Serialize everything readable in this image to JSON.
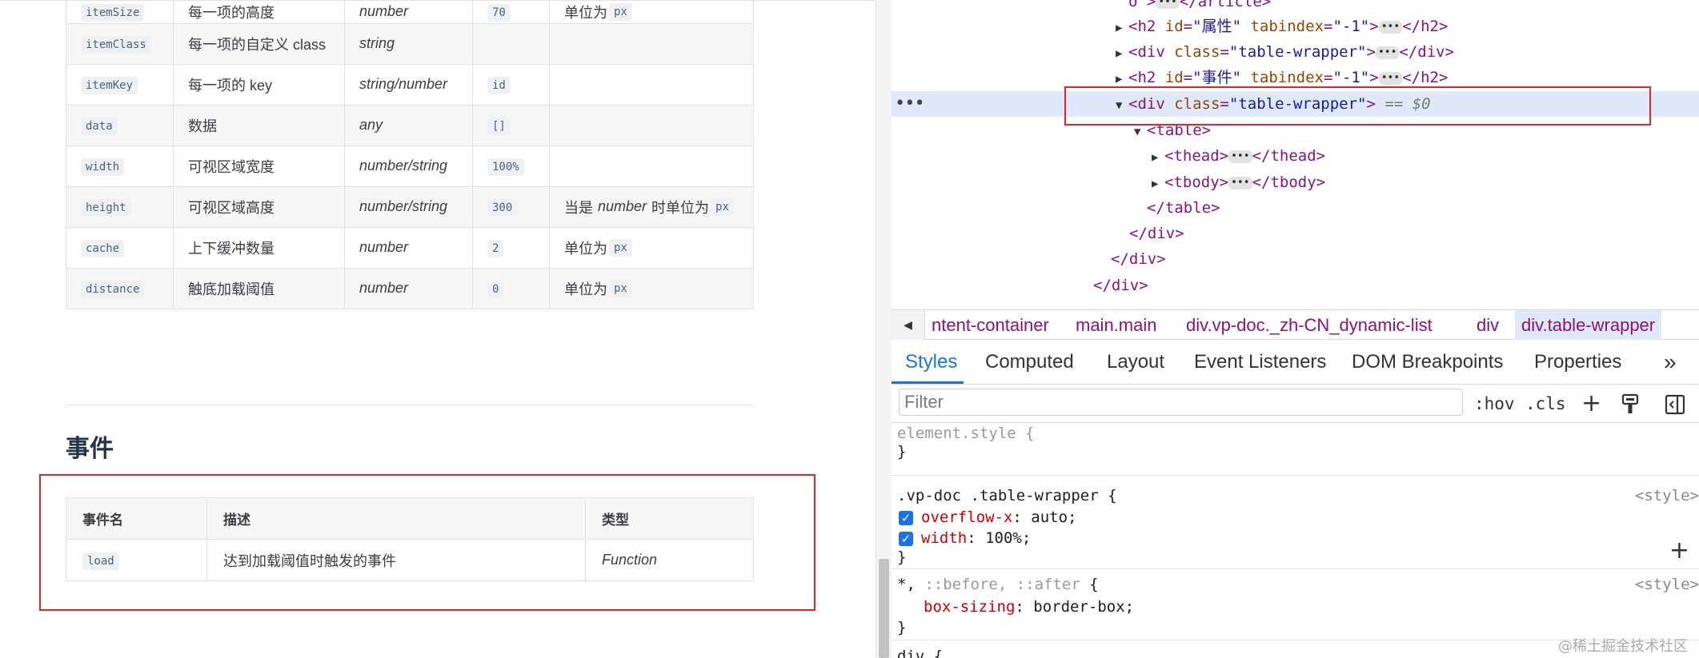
{
  "doc": {
    "props_rows": [
      {
        "name": "itemSize",
        "desc": "每一项的高度",
        "type": "number",
        "default": "70",
        "note_prefix": "单位为",
        "note_code": "px"
      },
      {
        "name": "itemClass",
        "desc": "每一项的自定义 class",
        "type": "string",
        "default": "",
        "note_prefix": "",
        "note_code": ""
      },
      {
        "name": "itemKey",
        "desc": "每一项的 key",
        "type": "string/number",
        "default": "id",
        "note_prefix": "",
        "note_code": ""
      },
      {
        "name": "data",
        "desc": "数据",
        "type": "any",
        "default": "[]",
        "note_prefix": "",
        "note_code": ""
      },
      {
        "name": "width",
        "desc": "可视区域宽度",
        "type": "number/string",
        "default": "100%",
        "note_prefix": "",
        "note_code": ""
      },
      {
        "name": "height",
        "desc": "可视区域高度",
        "type": "number/string",
        "default": "300",
        "note_prefix": "当是",
        "note_em": "number",
        "note_mid": "时单位为",
        "note_code": "px"
      },
      {
        "name": "cache",
        "desc": "上下缓冲数量",
        "type": "number",
        "default": "2",
        "note_prefix": "单位为",
        "note_code": "px"
      },
      {
        "name": "distance",
        "desc": "触底加载阈值",
        "type": "number",
        "default": "0",
        "note_prefix": "单位为",
        "note_code": "px"
      }
    ],
    "events_heading": "事件",
    "events_headers": [
      "事件名",
      "描述",
      "类型"
    ],
    "events_rows": [
      {
        "name": "load",
        "desc": "达到加载阈值时触发的事件",
        "type": "Function"
      }
    ]
  },
  "devtools": {
    "dom_lines": {
      "l0": "o >",
      "l0_tail": "</article>",
      "h2_attr1": "属性",
      "h2_attr2": "事件",
      "tabindex": "-1",
      "wrapper_class": "table-wrapper",
      "eq0": "== $0",
      "ellipsis": "•••"
    },
    "breadcrumbs": [
      "ntent-container",
      "main.main",
      "div.vp-doc._zh-CN_dynamic-list",
      "div",
      "div.table-wrapper"
    ],
    "tabs": [
      "Styles",
      "Computed",
      "Layout",
      "Event Listeners",
      "DOM Breakpoints",
      "Properties",
      "»"
    ],
    "filter_placeholder": "Filter",
    "filter_buttons": [
      ":hov",
      ".cls"
    ],
    "rules": {
      "element_style": "element.style {",
      "close": "}",
      "r1_selector": ".vp-doc .table-wrapper {",
      "r1_p1_name": "overflow-x",
      "r1_p1_val": "auto;",
      "r1_p2_name": "width",
      "r1_p2_val": "100%;",
      "r2_selector_pre": "*,",
      "r2_selector_grey": " ::before, ::after",
      "r2_selector_post": " {",
      "r2_p1_name": "box-sizing",
      "r2_p1_val": "border-box;",
      "src": "<style>",
      "r3_selector": "div {"
    },
    "watermark": "@稀土掘金技术社区"
  }
}
